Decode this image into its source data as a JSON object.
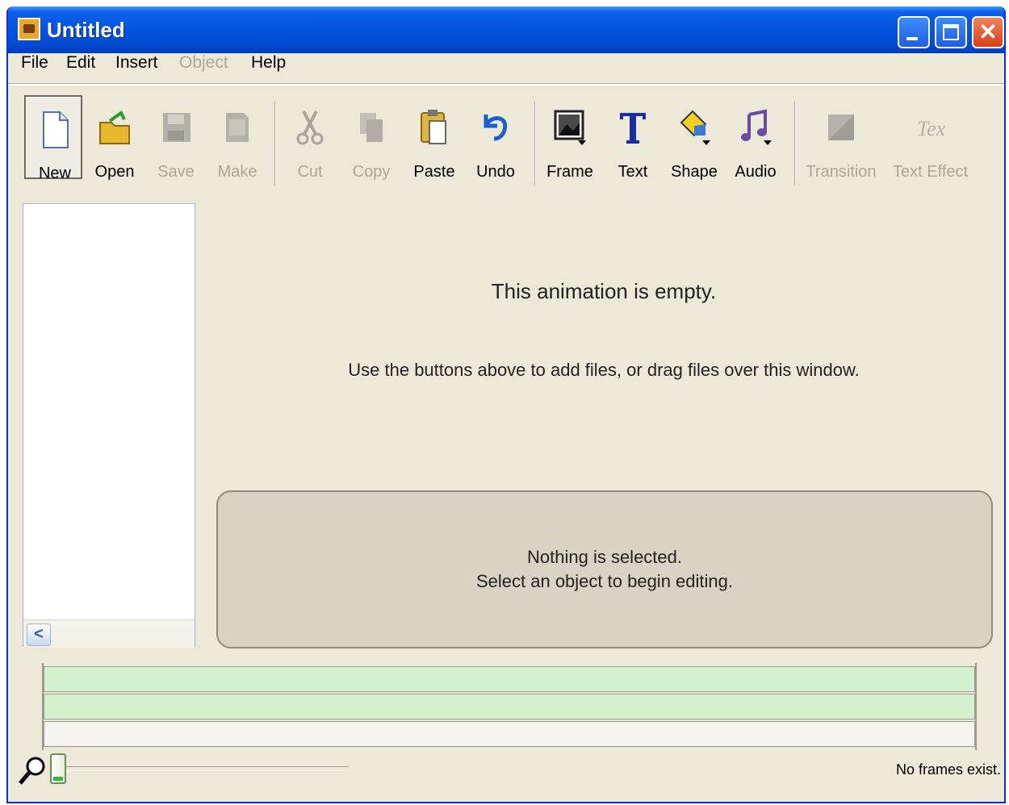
{
  "window": {
    "title": "Untitled",
    "close_glyph": "✕"
  },
  "menu": [
    "File",
    "Edit",
    "Insert",
    "Object",
    "Help"
  ],
  "toolbar": {
    "new": "New",
    "open": "Open",
    "save": "Save",
    "make": "Make",
    "cut": "Cut",
    "copy": "Copy",
    "paste": "Paste",
    "undo": "Undo",
    "frame": "Frame",
    "text": "Text",
    "shape": "Shape",
    "audio": "Audio",
    "transition": "Transition",
    "text_effect": "Text Effect"
  },
  "icons": [
    "new-document-icon",
    "open-folder-icon",
    "save-disk-icon",
    "make-icon",
    "scissors-icon",
    "copy-icon",
    "clipboard-icon",
    "undo-arrow-icon",
    "frame-picture-icon",
    "text-T-icon",
    "shape-icon",
    "music-note-icon",
    "transition-icon",
    "text-effect-icon",
    "zoom-magnifier-icon",
    "scroll-left-icon"
  ],
  "main": {
    "empty_title": "This animation is empty.",
    "empty_hint": "Use the buttons above to add files, or drag files over this window."
  },
  "properties": {
    "line1": "Nothing is selected.",
    "line2": "Select an object to begin editing."
  },
  "scroll_left": "<",
  "zoom_level": 0,
  "status": "No frames exist."
}
